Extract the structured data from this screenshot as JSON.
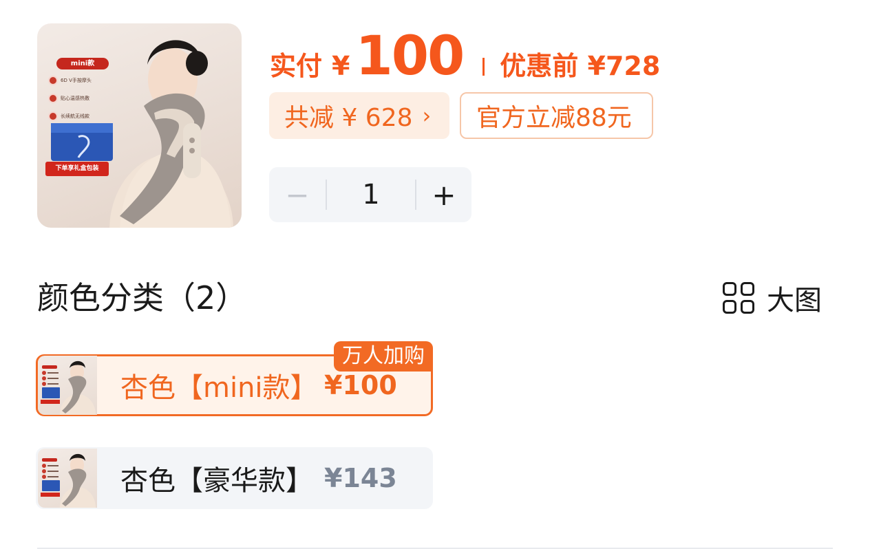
{
  "product": {
    "image_labels": {
      "title": "mini款",
      "features": [
        "6D V手按摩头",
        "贴心温感热敷",
        "长续航无线款"
      ],
      "gift": "下单享礼盒包装"
    }
  },
  "price": {
    "pay_label": "实付",
    "currency": "¥",
    "amount": "100",
    "before_label": "优惠前 ¥728"
  },
  "chips": {
    "total_discount": "共减 ¥ 628",
    "total_arrow": "›",
    "official": "官方立减88元"
  },
  "stepper": {
    "minus": "−",
    "quantity": "1",
    "plus": "+"
  },
  "section": {
    "title": "颜色分类（2）",
    "view_label": "大图"
  },
  "variants": [
    {
      "label": "杏色【mini款】",
      "price": "¥100",
      "badge": "万人加购",
      "selected": true
    },
    {
      "label": "杏色【豪华款】",
      "price": "¥143",
      "selected": false
    }
  ],
  "colors": {
    "accent": "#f5571c",
    "chip_bg": "#fdeee3",
    "neutral_bg": "#f3f5f8",
    "muted_price": "#7b8595"
  },
  "icons": {
    "view_toggle": "grid-icon",
    "chip_arrow": "chevron-right-icon"
  }
}
